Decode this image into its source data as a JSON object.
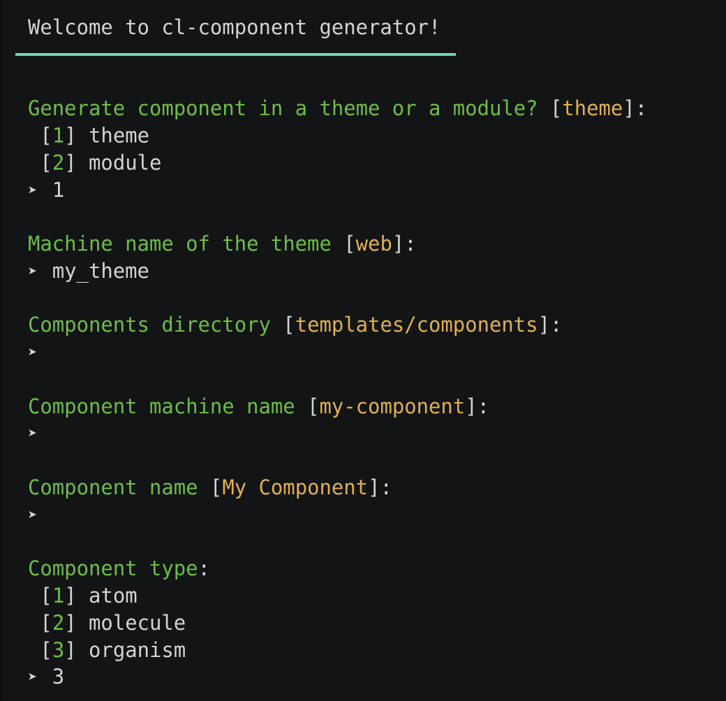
{
  "terminal": {
    "title": "Welcome to cl-component generator!",
    "colors": {
      "background": "#131416",
      "prompt": "#6cbf43",
      "default_value": "#e0b050",
      "text": "#d4d4d4",
      "rule": "#6fd8b4"
    },
    "arrow_glyph": "➤",
    "prompts": [
      {
        "question": "Generate component in a theme or a module?",
        "default": "theme",
        "options": [
          {
            "num": "1",
            "label": "theme"
          },
          {
            "num": "2",
            "label": "module"
          }
        ],
        "answer": "1"
      },
      {
        "question": "Machine name of the theme",
        "default": "web",
        "answer": "my_theme"
      },
      {
        "question": "Components directory",
        "default": "templates/components",
        "answer": ""
      },
      {
        "question": "Component machine name",
        "default": "my-component",
        "answer": ""
      },
      {
        "question": "Component name",
        "default": "My Component",
        "answer": ""
      },
      {
        "question": "Component type",
        "options": [
          {
            "num": "1",
            "label": "atom"
          },
          {
            "num": "2",
            "label": "molecule"
          },
          {
            "num": "3",
            "label": "organism"
          }
        ],
        "answer": "3"
      }
    ]
  }
}
